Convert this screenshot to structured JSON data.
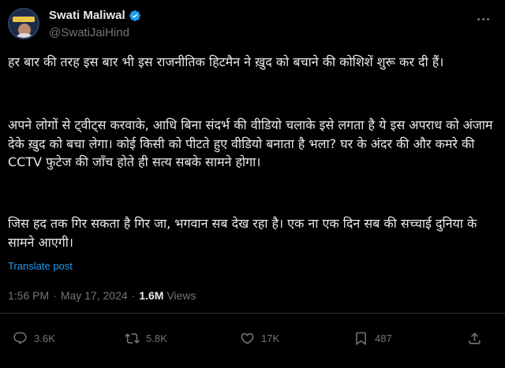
{
  "author": {
    "display_name": "Swati Maliwal",
    "handle": "@SwatiJaiHind",
    "verified": true
  },
  "tweet": {
    "paragraphs": [
      "हर बार की तरह इस बार भी इस राजनीतिक हिटमैन ने ख़ुद को बचाने की कोशिशें शुरू कर दी हैं।",
      "अपने लोगों से ट्वीट्स करवाके, आधि बिना संदर्भ की वीडियो चलाके इसे लगता है ये इस अपराध को अंजाम देके ख़ुद को बचा लेगा। कोई किसी को पीटते हुए वीडियो बनाता है भला? घर के अंदर की और कमरे की CCTV फुटेज की जाँच होते ही सत्य सबके सामने होगा।",
      "जिस हद तक गिर सकता है गिर जा, भगवान सब देख रहा है। एक ना एक दिन सब की सच्चाई दुनिया के सामने आएगी।"
    ],
    "translate_label": "Translate post",
    "time": "1:56 PM",
    "date": "May 17, 2024",
    "separator": "·",
    "views_count": "1.6M",
    "views_label": "Views"
  },
  "actions": {
    "reply_count": "3.6K",
    "retweet_count": "5.8K",
    "like_count": "17K",
    "bookmark_count": "487"
  },
  "colors": {
    "background": "#000000",
    "text": "#e7e9ea",
    "muted": "#71767b",
    "accent": "#1d9bf0",
    "divider": "#2f3336"
  },
  "icons": [
    "verified-badge-icon",
    "more-icon",
    "reply-icon",
    "retweet-icon",
    "like-icon",
    "bookmark-icon",
    "share-icon"
  ]
}
